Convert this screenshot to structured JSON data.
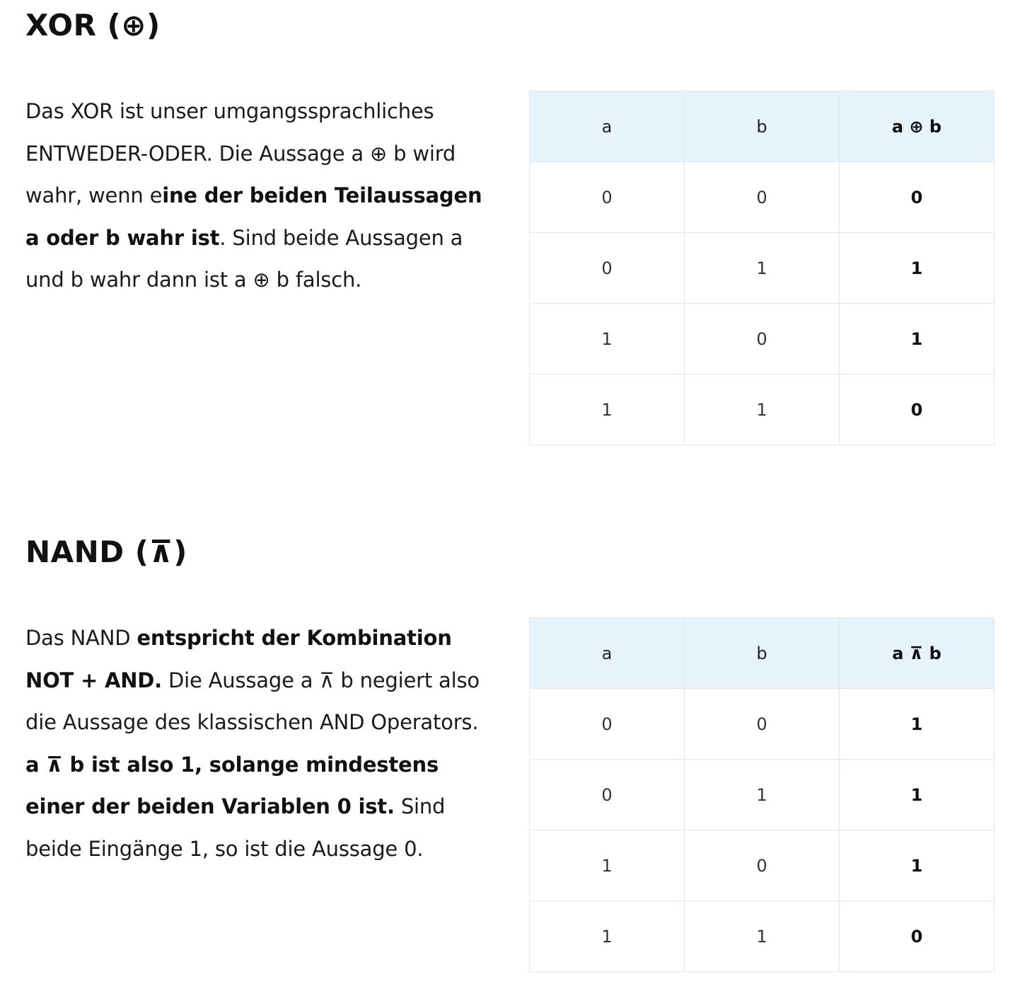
{
  "xor": {
    "heading": "XOR (⊕)",
    "para": [
      {
        "t": "Das XOR ist unser umgangssprachliches ENTWEDER-ODER. Die Aussage a ⊕ b wird wahr, wenn e",
        "b": false
      },
      {
        "t": "ine der beiden Teilaussagen a oder b wahr ist",
        "b": true
      },
      {
        "t": ". Sind beide Aussagen a und b wahr dann ist a ⊕ b falsch.",
        "b": false
      }
    ],
    "table": {
      "headers": [
        "a",
        "b",
        "a ⊕ b"
      ],
      "rows": [
        [
          "0",
          "0",
          "0"
        ],
        [
          "0",
          "1",
          "1"
        ],
        [
          "1",
          "0",
          "1"
        ],
        [
          "1",
          "1",
          "0"
        ]
      ]
    }
  },
  "nand": {
    "heading": "NAND (⊼)",
    "para": [
      {
        "t": "Das NAND ",
        "b": false
      },
      {
        "t": "entspricht der Kombination NOT + AND.",
        "b": true
      },
      {
        "t": " Die Aussage a ⊼ b negiert also die Aussage des klassischen AND Operators. ",
        "b": false
      },
      {
        "t": "a ⊼ b ist also 1, solange mindestens einer der beiden Variablen 0 ist.",
        "b": true
      },
      {
        "t": " Sind beide Eingänge 1, so ist die Aussage 0.",
        "b": false
      }
    ],
    "table": {
      "headers": [
        "a",
        "b",
        "a ⊼ b"
      ],
      "rows": [
        [
          "0",
          "0",
          "1"
        ],
        [
          "0",
          "1",
          "1"
        ],
        [
          "1",
          "0",
          "1"
        ],
        [
          "1",
          "1",
          "0"
        ]
      ]
    }
  },
  "colors": {
    "header_bg": "#e6f3fb",
    "border": "#e3e6ea",
    "text": "#111111"
  }
}
